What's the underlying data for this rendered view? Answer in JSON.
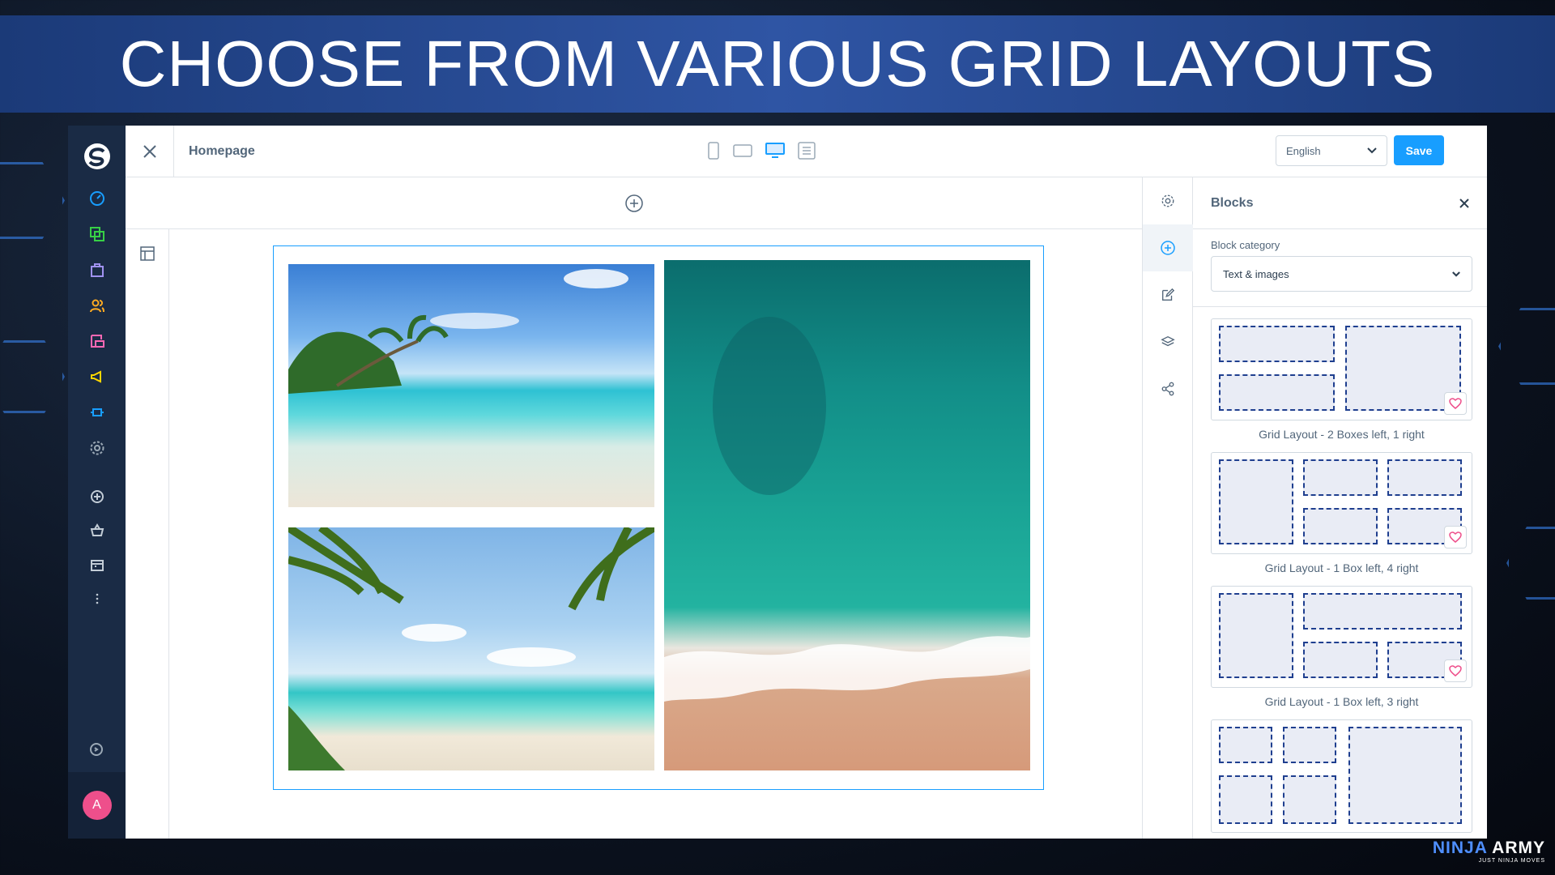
{
  "banner": {
    "title": "CHOOSE FROM VARIOUS GRID LAYOUTS"
  },
  "topbar": {
    "page_name": "Homepage",
    "language": "English",
    "save_label": "Save"
  },
  "nav": {
    "icons": [
      "dashboard-icon",
      "catalogue-icon",
      "orders-icon",
      "customers-icon",
      "content-icon",
      "marketing-icon",
      "extensions-icon",
      "settings-icon"
    ],
    "avatar_letter": "A"
  },
  "panel": {
    "title": "Blocks",
    "category_label": "Block category",
    "category_value": "Text & images",
    "blocks": [
      {
        "label": "Grid Layout - 2 Boxes left, 1 right"
      },
      {
        "label": "Grid Layout - 1 Box left, 4 right"
      },
      {
        "label": "Grid Layout - 1 Box left, 3 right"
      },
      {
        "label": ""
      }
    ]
  },
  "brand": {
    "name_a": "NINJA",
    "name_b": " ARMY",
    "tagline": "JUST NINJA MOVES"
  },
  "colors": {
    "accent": "#189eff",
    "nav_bg": "#1a2b45",
    "banner": "#2f55a4",
    "dashed": "#1f3f8f"
  }
}
